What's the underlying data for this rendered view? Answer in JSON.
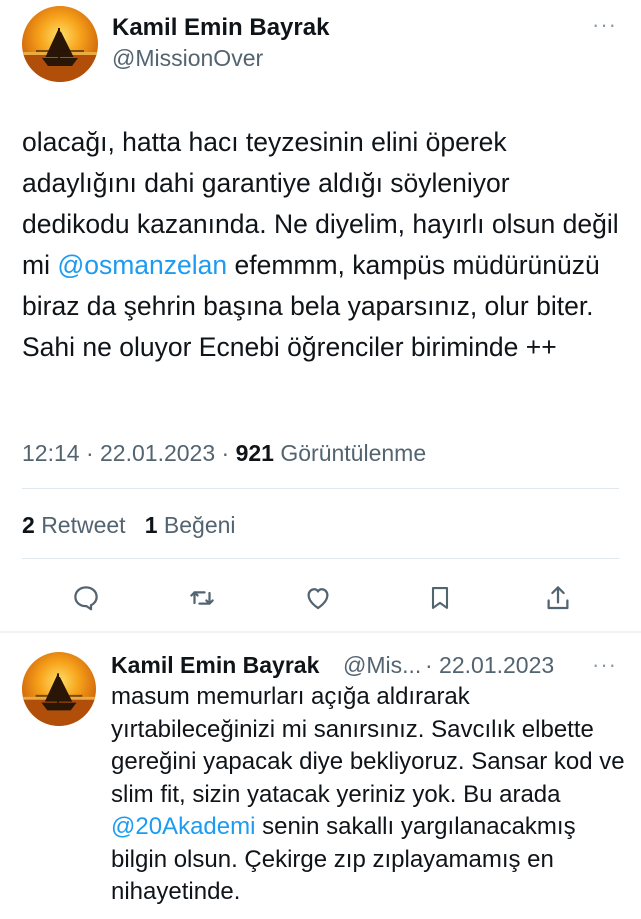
{
  "main_tweet": {
    "author_name": "Kamil Emin Bayrak",
    "author_handle": "@MissionOver",
    "more_label": "···",
    "text_part1": "olacağı, hatta hacı teyzesinin elini öperek adaylığını dahi garantiye aldığı söyleniyor dedikodu kazanında. Ne diyelim, hayırlı olsun değil mi ",
    "mention": "@osmanzelan",
    "text_part2": " efemmm, kampüs müdürünüzü biraz da şehrin başına bela yaparsınız, olur biter. Sahi ne oluyor Ecnebi öğrenciler biriminde ++",
    "time": "12:14",
    "date": "22.01.2023",
    "separator": " · ",
    "views_count": "921",
    "views_label": "Görüntülenme",
    "retweets_count": "2",
    "retweets_label": "Retweet",
    "likes_count": "1",
    "likes_label": "Beğeni"
  },
  "actions": [
    {
      "name": "reply",
      "icon": "reply-icon"
    },
    {
      "name": "retweet",
      "icon": "retweet-icon"
    },
    {
      "name": "like",
      "icon": "heart-icon"
    },
    {
      "name": "bookmark",
      "icon": "bookmark-icon"
    },
    {
      "name": "share",
      "icon": "share-icon"
    }
  ],
  "reply_tweet": {
    "author_name": "Kamil Emin Bayrak",
    "author_handle": "@Mis...",
    "date": "· 22.01.2023",
    "more_label": "···",
    "text_part1": "masum memurları açığa aldırarak yırtabileceğinizi mi sanırsınız. Savcılık elbette gereğini yapacak diye bekliyoruz. Sansar kod ve slim fit, sizin yatacak yeriniz yok. Bu arada ",
    "mention": "@20Akademi",
    "text_part2": " senin sakallı yargılanacakmış bilgin olsun. Çekirge zıp zıplayamamış en nihayetinde."
  },
  "colors": {
    "text": "#0f1419",
    "secondary": "#536471",
    "link": "#1d9bf0",
    "divider": "#e1e8ed",
    "icon": "#536471"
  }
}
